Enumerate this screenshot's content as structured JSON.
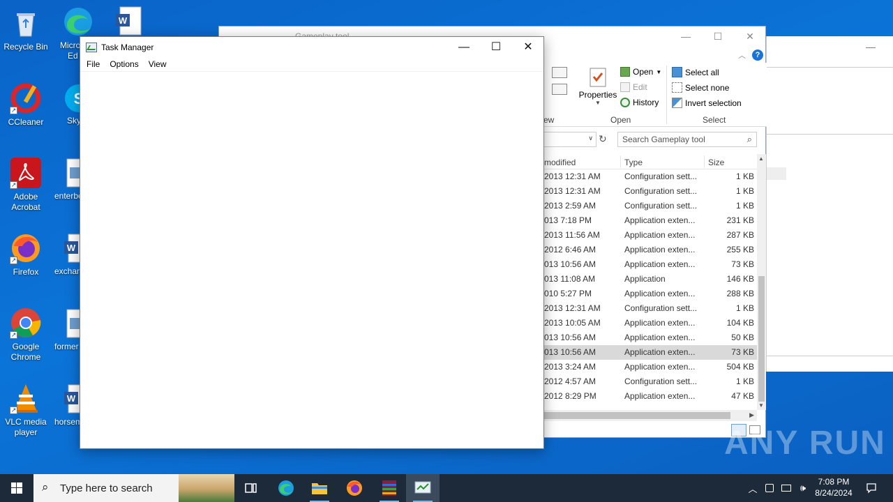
{
  "desktop": {
    "icons": [
      {
        "label": "Recycle Bin"
      },
      {
        "label": "CCleaner"
      },
      {
        "label": "Adobe Acrobat"
      },
      {
        "label": "Firefox"
      },
      {
        "label": "Google Chrome"
      },
      {
        "label": "VLC media player"
      }
    ],
    "clipped_labels": [
      "Micro",
      "Ed",
      "Sky",
      "enterbe",
      "exchan",
      "former",
      "horsem"
    ]
  },
  "explorer": {
    "title": "Gameplay tool",
    "ribbon": {
      "properties": "Properties",
      "open": "Open",
      "edit": "Edit",
      "history": "History",
      "select_all": "Select all",
      "select_none": "Select none",
      "invert_selection": "Invert selection",
      "group_open": "Open",
      "group_select": "Select",
      "group_view_clip": "ew"
    },
    "search_placeholder": "Search Gameplay tool",
    "columns": {
      "modified": "modified",
      "type": "Type",
      "size": "Size"
    },
    "rows": [
      {
        "modified": "2013 12:31 AM",
        "type": "Configuration sett...",
        "size": "1 KB"
      },
      {
        "modified": "2013 12:31 AM",
        "type": "Configuration sett...",
        "size": "1 KB"
      },
      {
        "modified": "2013 2:59 AM",
        "type": "Configuration sett...",
        "size": "1 KB"
      },
      {
        "modified": "013 7:18 PM",
        "type": "Application exten...",
        "size": "231 KB"
      },
      {
        "modified": "2013 11:56 AM",
        "type": "Application exten...",
        "size": "287 KB"
      },
      {
        "modified": "2012 6:46 AM",
        "type": "Application exten...",
        "size": "255 KB"
      },
      {
        "modified": "013 10:56 AM",
        "type": "Application exten...",
        "size": "73 KB"
      },
      {
        "modified": "013 11:08 AM",
        "type": "Application",
        "size": "146 KB"
      },
      {
        "modified": "010 5:27 PM",
        "type": "Application exten...",
        "size": "288 KB"
      },
      {
        "modified": "2013 12:31 AM",
        "type": "Configuration sett...",
        "size": "1 KB"
      },
      {
        "modified": "2013 10:05 AM",
        "type": "Application exten...",
        "size": "104 KB"
      },
      {
        "modified": "013 10:56 AM",
        "type": "Application exten...",
        "size": "50 KB"
      },
      {
        "modified": "013 10:56 AM",
        "type": "Application exten...",
        "size": "73 KB"
      },
      {
        "modified": "2013 3:24 AM",
        "type": "Application exten...",
        "size": "504 KB"
      },
      {
        "modified": "2012 4:57 AM",
        "type": "Configuration sett...",
        "size": "1 KB"
      },
      {
        "modified": "2012 8:29 PM",
        "type": "Application exten...",
        "size": "47 KB"
      }
    ],
    "selected_row": 12
  },
  "taskmgr": {
    "title": "Task Manager",
    "menu": [
      "File",
      "Options",
      "View"
    ]
  },
  "taskbar": {
    "search_placeholder": "Type here to search",
    "time": "7:08 PM",
    "date": "8/24/2024"
  },
  "watermark": "ANY RUN",
  "colors": {
    "desktop": "#0b74d8",
    "taskbar": "#1c2a3a",
    "selection": "#d9d9d9"
  }
}
